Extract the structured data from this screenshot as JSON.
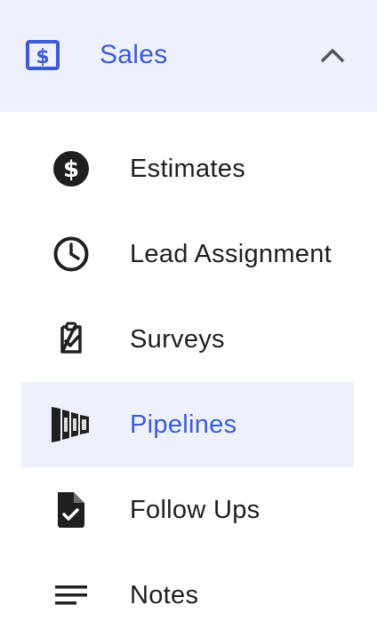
{
  "section": {
    "label": "Sales",
    "icon": "dollar-bill-icon",
    "expanded": true,
    "accent_color": "#3b5bd9",
    "highlight_color": "#eef1fb"
  },
  "items": [
    {
      "label": "Estimates",
      "icon": "dollar-circle-icon",
      "active": false
    },
    {
      "label": "Lead Assignment",
      "icon": "clock-icon",
      "active": false
    },
    {
      "label": "Surveys",
      "icon": "clipboard-check-icon",
      "active": false
    },
    {
      "label": "Pipelines",
      "icon": "pipeline-funnel-icon",
      "active": true
    },
    {
      "label": "Follow Ups",
      "icon": "document-check-icon",
      "active": false
    },
    {
      "label": "Notes",
      "icon": "notes-lines-icon",
      "active": false
    }
  ]
}
